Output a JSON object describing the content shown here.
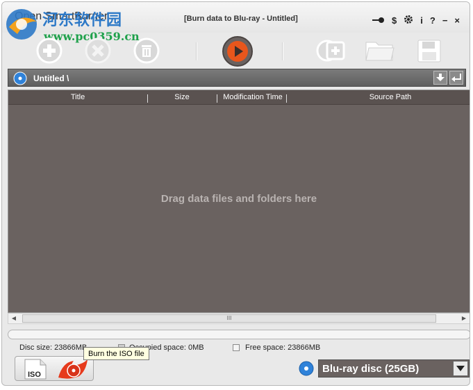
{
  "app": {
    "name": "Open SmartBurner",
    "window_title": "[Burn data to Blu-ray - Untitled]",
    "watermark_line1": "河东软件园",
    "watermark_line2": "www.pc0359.cn"
  },
  "window_controls": {
    "key_icon": "key-icon",
    "dollar": "$",
    "gear_icon": "gear-icon",
    "info": "i",
    "help": "?",
    "minimize": "−",
    "close": "×"
  },
  "toolbar": {
    "items": [
      "add-icon",
      "remove-icon",
      "delete-icon",
      "burn-icon",
      "add-disc-icon",
      "open-folder-icon",
      "save-icon"
    ]
  },
  "pathbar": {
    "path": "Untitled \\"
  },
  "file_list": {
    "columns": [
      "Title",
      "Size",
      "Modification Time",
      "Source Path"
    ],
    "empty_message": "Drag data files and folders here",
    "scroll_thumb_grip": "III"
  },
  "status": {
    "disc_size": "Disc size: 23866MB",
    "occupied": "Occupied space: 0MB",
    "free": "Free space: 23866MB"
  },
  "iso_button": {
    "label": "ISO",
    "tooltip": "Burn the ISO file"
  },
  "disc_type": {
    "selected": "Blu-ray disc (25GB)"
  },
  "colors": {
    "list_bg": "#6a6260",
    "header_bg": "#5a5250",
    "burn_orange": "#e8561c",
    "disc_blue": "#2f82d9"
  }
}
